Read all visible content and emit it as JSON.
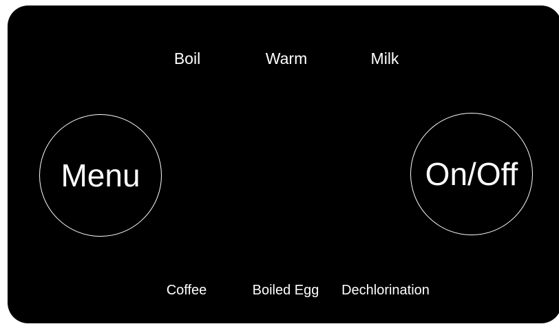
{
  "panel": {
    "background_color": "#000000",
    "text_color": "#ffffff"
  },
  "top_modes": [
    {
      "label": "Boil"
    },
    {
      "label": "Warm"
    },
    {
      "label": "Milk"
    }
  ],
  "bottom_modes": [
    {
      "label": "Coffee"
    },
    {
      "label": "Boiled Egg"
    },
    {
      "label": "Dechlorination"
    }
  ],
  "menu_button": {
    "label": "Menu"
  },
  "power_button": {
    "label": "On/Off"
  }
}
